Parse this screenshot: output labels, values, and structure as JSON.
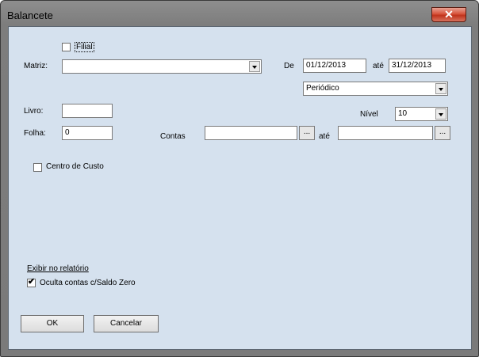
{
  "window": {
    "title": "Balancete",
    "close_label": "✕"
  },
  "filial": {
    "label": "Filial",
    "checked": false
  },
  "matriz": {
    "label": "Matriz:",
    "value": ""
  },
  "periodo": {
    "de_label": "De",
    "start": "01/12/2013",
    "ate_label": "até",
    "end": "31/12/2013",
    "type": "Periódico"
  },
  "livro": {
    "label": "Livro:",
    "value": ""
  },
  "nivel": {
    "label": "Nível",
    "value": "10"
  },
  "folha": {
    "label": "Folha:",
    "value": "0"
  },
  "contas": {
    "label": "Contas",
    "from": "",
    "dots": "...",
    "ate_label": "até",
    "to": "",
    "dots2": "..."
  },
  "centro_custo": {
    "label": "Centro de Custo",
    "checked": false
  },
  "exibir": {
    "heading": "Exibir no relatório",
    "oculta_label": "Oculta contas c/Saldo Zero",
    "oculta_checked": true,
    "check_glyph": "✔"
  },
  "buttons": {
    "ok": "OK",
    "cancel": "Cancelar"
  },
  "colors": {
    "client_bg": "#d5e1ee",
    "close_red": "#c0331b"
  }
}
